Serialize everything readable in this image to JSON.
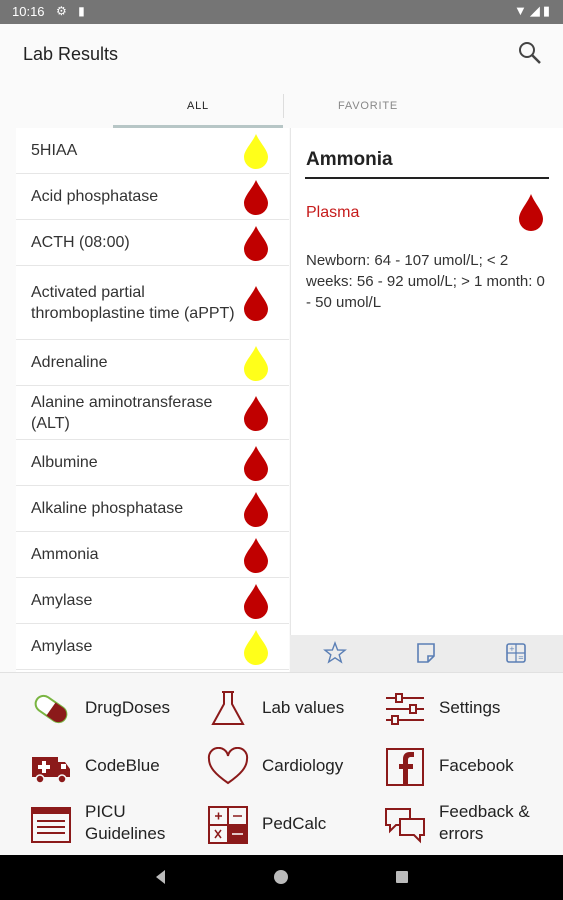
{
  "status": {
    "time": "10:16"
  },
  "appbar": {
    "title": "Lab Results"
  },
  "tabs": {
    "all": "ALL",
    "favorite": "FAVORITE"
  },
  "list": [
    {
      "label": "5HIAA",
      "drop": "yellow"
    },
    {
      "label": "Acid phosphatase",
      "drop": "red"
    },
    {
      "label": "ACTH (08:00)",
      "drop": "red"
    },
    {
      "label": "Activated partial thromboplastine time (aPPT)",
      "drop": "red"
    },
    {
      "label": "Adrenaline",
      "drop": "yellow"
    },
    {
      "label": "Alanine aminotransferase (ALT)",
      "drop": "red"
    },
    {
      "label": "Albumine",
      "drop": "red"
    },
    {
      "label": "Alkaline phosphatase",
      "drop": "red"
    },
    {
      "label": "Ammonia",
      "drop": "red"
    },
    {
      "label": "Amylase",
      "drop": "red"
    },
    {
      "label": "Amylase",
      "drop": "yellow"
    }
  ],
  "detail": {
    "name": "Ammonia",
    "sample": "Plasma",
    "reference": "Newborn: 64 - 107 umol/L; < 2 weeks: 56 - 92 umol/L; > 1 month: 0 - 50 umol/L"
  },
  "nav": {
    "drugdoses": "DrugDoses",
    "labvalues": "Lab values",
    "settings": "Settings",
    "codeblue": "CodeBlue",
    "cardiology": "Cardiology",
    "facebook": "Facebook",
    "picu_line1": "PICU",
    "picu_line2": "Guidelines",
    "pedcalc": "PedCalc",
    "feedback_line1": "Feedback &",
    "feedback_line2": "errors"
  },
  "colors": {
    "red_drop": "#c00000",
    "yellow_drop": "#ffff1a",
    "accent": "#8b1a1a"
  }
}
